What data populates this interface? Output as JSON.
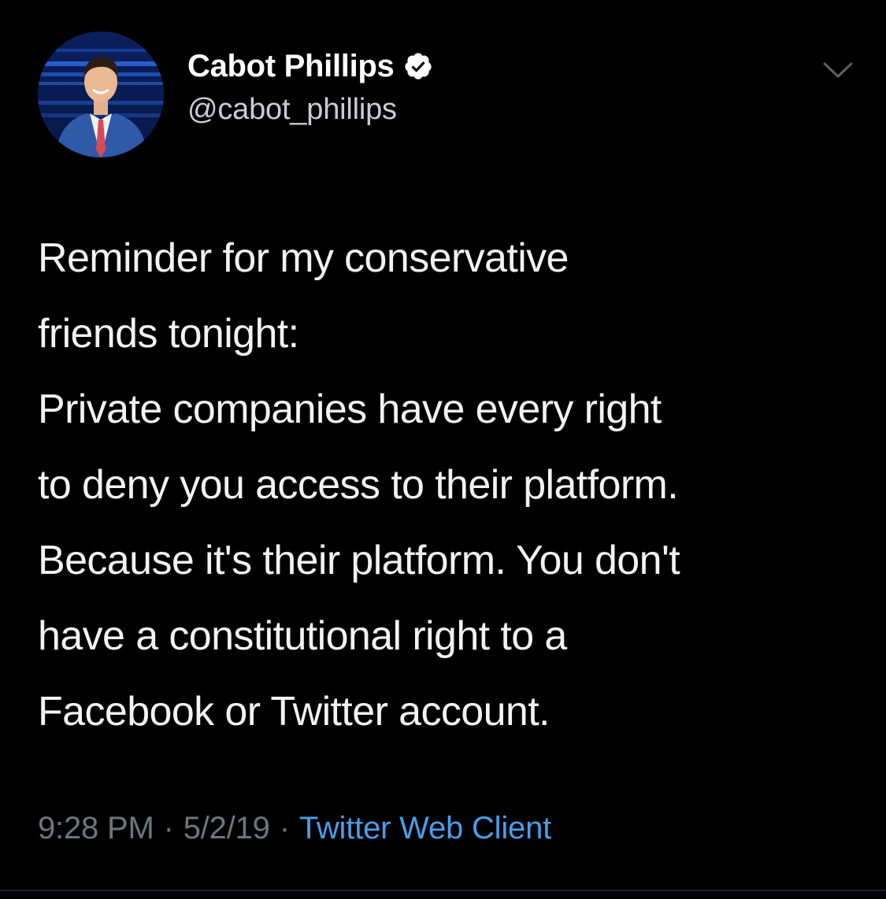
{
  "author": {
    "display_name": "Cabot Phillips",
    "handle": "@cabot_phillips",
    "verified": true,
    "avatar_icon": "profile-photo"
  },
  "tweet": {
    "paragraphs": [
      {
        "lines": [
          "Reminder for my conservative",
          "friends tonight:"
        ]
      },
      {
        "lines": [
          "Private companies have every right",
          "to deny you access to their platform.",
          "Because it's their platform. You don't",
          "have a constitutional right to a",
          "Facebook or Twitter account."
        ]
      }
    ]
  },
  "meta": {
    "time": "9:28 PM",
    "separator": "·",
    "date": "5/2/19",
    "source": "Twitter Web Client"
  },
  "colors": {
    "background": "#000000",
    "text": "#f2f2f2",
    "muted": "#6e767d",
    "link": "#4a9eea"
  },
  "icons": {
    "verified": "verified-badge-icon",
    "menu": "chevron-down-icon"
  }
}
